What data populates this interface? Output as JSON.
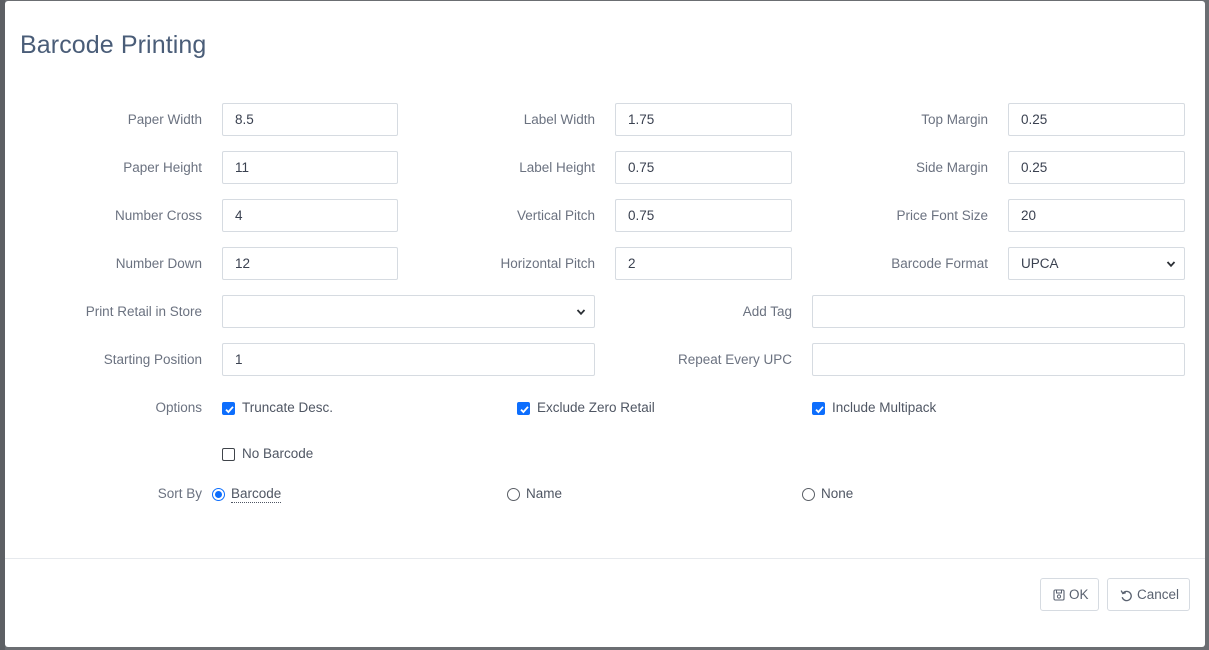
{
  "dialog": {
    "title": "Barcode Printing"
  },
  "fields": {
    "paper_width": {
      "label": "Paper Width",
      "value": "8.5"
    },
    "paper_height": {
      "label": "Paper Height",
      "value": "11"
    },
    "number_cross": {
      "label": "Number Cross",
      "value": "4"
    },
    "number_down": {
      "label": "Number Down",
      "value": "12"
    },
    "label_width": {
      "label": "Label Width",
      "value": "1.75"
    },
    "label_height": {
      "label": "Label Height",
      "value": "0.75"
    },
    "vertical_pitch": {
      "label": "Vertical Pitch",
      "value": "0.75"
    },
    "horizontal_pitch": {
      "label": "Horizontal Pitch",
      "value": "2"
    },
    "top_margin": {
      "label": "Top Margin",
      "value": "0.25"
    },
    "side_margin": {
      "label": "Side Margin",
      "value": "0.25"
    },
    "price_font_size": {
      "label": "Price Font Size",
      "value": "20"
    },
    "barcode_format": {
      "label": "Barcode Format",
      "value": "UPCA"
    },
    "print_retail_in_store": {
      "label": "Print Retail in Store",
      "value": ""
    },
    "add_tag": {
      "label": "Add Tag",
      "value": ""
    },
    "starting_position": {
      "label": "Starting Position",
      "value": "1"
    },
    "repeat_every_upc": {
      "label": "Repeat Every UPC",
      "value": ""
    }
  },
  "options": {
    "label": "Options",
    "truncate_desc": {
      "label": "Truncate Desc.",
      "checked": true
    },
    "exclude_zero_retail": {
      "label": "Exclude Zero Retail",
      "checked": true
    },
    "include_multipack": {
      "label": "Include Multipack",
      "checked": true
    },
    "no_barcode": {
      "label": "No Barcode",
      "checked": false
    }
  },
  "sort_by": {
    "label": "Sort By",
    "selected": "Barcode",
    "choices": [
      "Barcode",
      "Name",
      "None"
    ]
  },
  "footer": {
    "ok_label": "OK",
    "cancel_label": "Cancel"
  },
  "colors": {
    "accent": "#0d6efd",
    "title": "#4a5d78",
    "label": "#6b7280"
  }
}
